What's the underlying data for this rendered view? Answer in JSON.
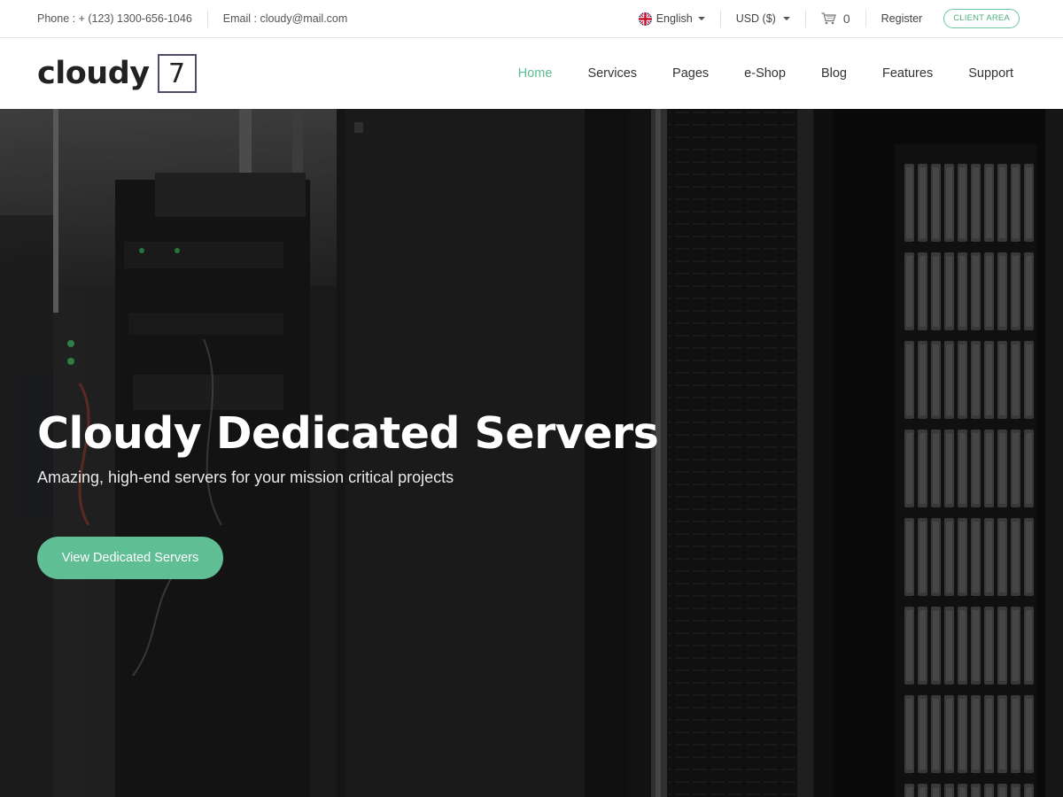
{
  "topbar": {
    "phone": "Phone : + (123) 1300-656-1046",
    "email": "Email : cloudy@mail.com",
    "language": "English",
    "currency": "USD ($)",
    "cart_count": "0",
    "register": "Register",
    "client_area": "CLIENT AREA"
  },
  "logo": {
    "word": "cloudy",
    "number": "7"
  },
  "nav": {
    "items": [
      {
        "label": "Home",
        "active": true
      },
      {
        "label": "Services"
      },
      {
        "label": "Pages"
      },
      {
        "label": "e-Shop"
      },
      {
        "label": "Blog"
      },
      {
        "label": "Features"
      },
      {
        "label": "Support"
      }
    ]
  },
  "hero": {
    "title": "Cloudy Dedicated Servers",
    "subtitle": "Amazing, high-end servers for your mission critical projects",
    "cta": "View Dedicated Servers"
  },
  "colors": {
    "accent": "#60be94",
    "nav_active": "#5bbd92",
    "hero_bg": "#1b1b1b",
    "text_dark": "#222222"
  },
  "icons": {
    "cart": "cart-icon",
    "language_flag": "uk-flag-icon",
    "dropdown": "caret-down-icon"
  }
}
